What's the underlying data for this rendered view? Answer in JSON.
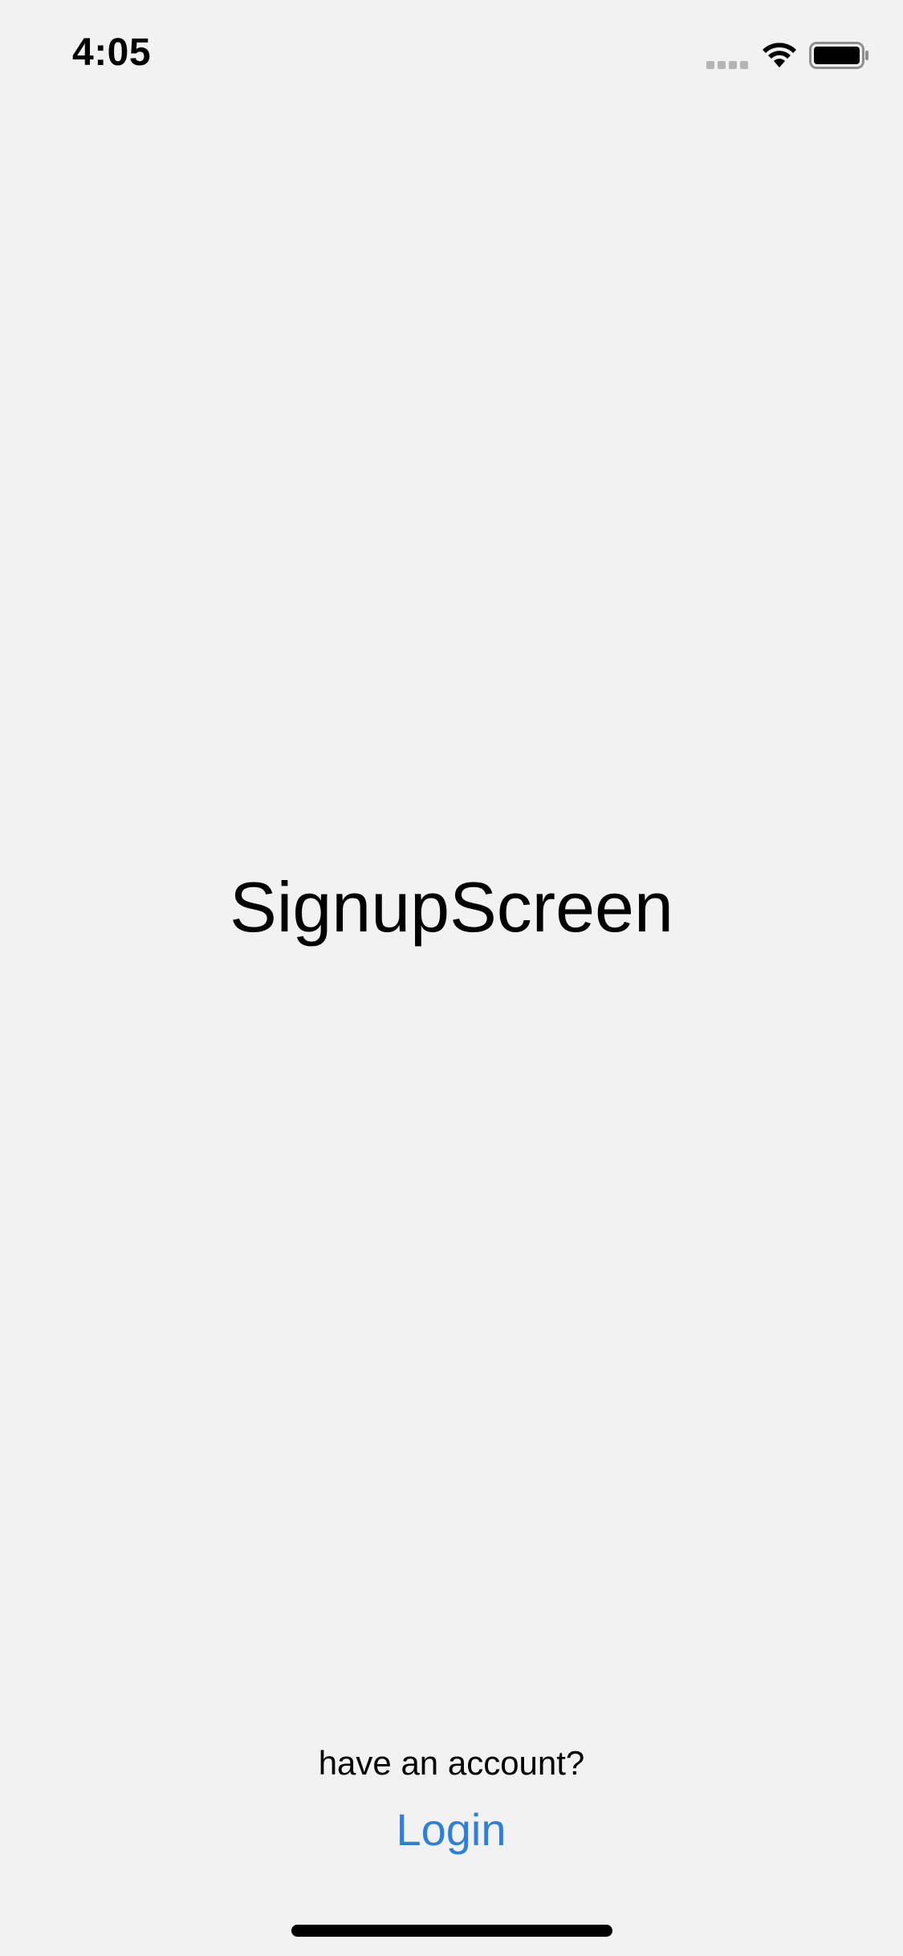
{
  "status_bar": {
    "time": "4:05",
    "icons": [
      "cellular-signal-icon",
      "wifi-icon",
      "battery-icon"
    ]
  },
  "main": {
    "title": "SignupScreen"
  },
  "footer": {
    "prompt": "have an account?",
    "login_label": "Login",
    "login_color": "#2e7fd9"
  }
}
